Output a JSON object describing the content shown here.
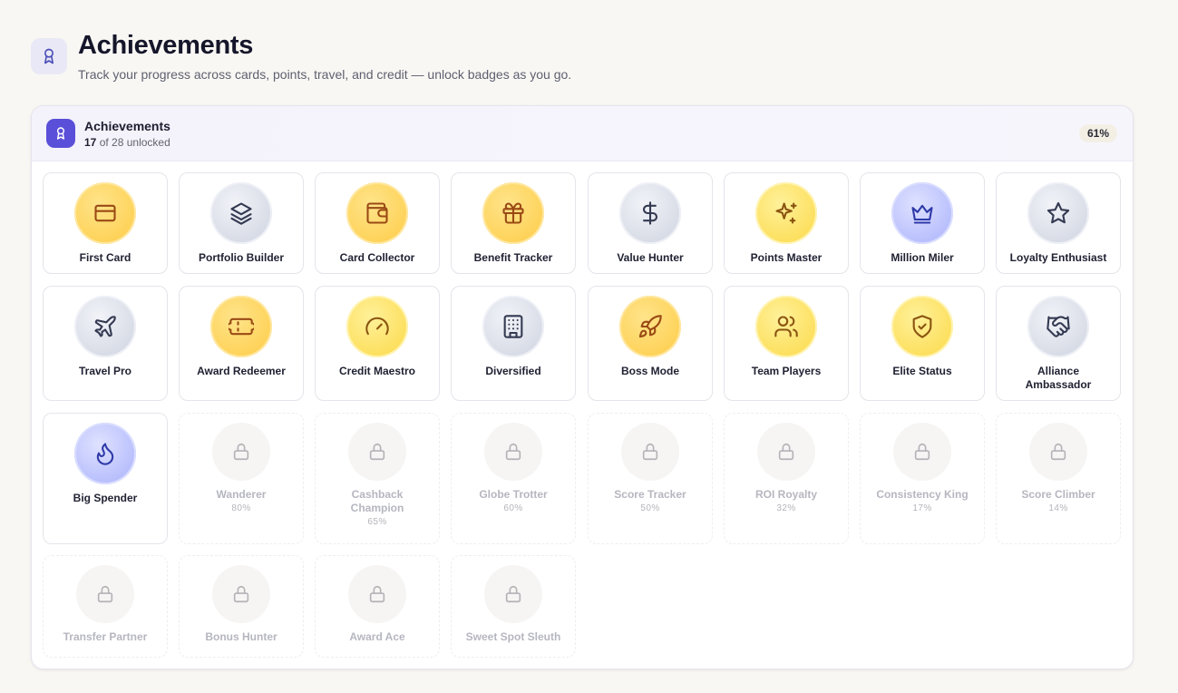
{
  "header": {
    "title": "Achievements",
    "subtitle": "Track your progress across cards, points, travel, and credit — unlock badges as you go."
  },
  "panel": {
    "title": "Achievements",
    "unlocked_count": "17",
    "count_suffix": " of 28 unlocked",
    "percent": "61%"
  },
  "colors": {
    "accent": "#5a4fd8",
    "gold": "#fdcb45",
    "yellow": "#fbd845",
    "silver": "#cdd2de",
    "blue": "#a8b0fb"
  },
  "achievements": [
    {
      "label": "First Card",
      "icon": "credit-card-icon",
      "tier": "gold",
      "unlocked": true
    },
    {
      "label": "Portfolio Builder",
      "icon": "layers-icon",
      "tier": "silver",
      "unlocked": true
    },
    {
      "label": "Card Collector",
      "icon": "wallet-icon",
      "tier": "gold",
      "unlocked": true
    },
    {
      "label": "Benefit Tracker",
      "icon": "gift-icon",
      "tier": "gold",
      "unlocked": true
    },
    {
      "label": "Value Hunter",
      "icon": "dollar-icon",
      "tier": "silver",
      "unlocked": true
    },
    {
      "label": "Points Master",
      "icon": "sparkles-icon",
      "tier": "yellow",
      "unlocked": true
    },
    {
      "label": "Million Miler",
      "icon": "crown-icon",
      "tier": "blue",
      "unlocked": true
    },
    {
      "label": "Loyalty Enthusiast",
      "icon": "star-icon",
      "tier": "silver",
      "unlocked": true
    },
    {
      "label": "Travel Pro",
      "icon": "plane-icon",
      "tier": "silver",
      "unlocked": true
    },
    {
      "label": "Award Redeemer",
      "icon": "ticket-icon",
      "tier": "gold",
      "unlocked": true
    },
    {
      "label": "Credit Maestro",
      "icon": "gauge-icon",
      "tier": "yellow",
      "unlocked": true
    },
    {
      "label": "Diversified",
      "icon": "building-icon",
      "tier": "silver",
      "unlocked": true
    },
    {
      "label": "Boss Mode",
      "icon": "rocket-icon",
      "tier": "gold",
      "unlocked": true
    },
    {
      "label": "Team Players",
      "icon": "users-icon",
      "tier": "yellow",
      "unlocked": true
    },
    {
      "label": "Elite Status",
      "icon": "shield-check-icon",
      "tier": "yellow",
      "unlocked": true
    },
    {
      "label": "Alliance Ambassador",
      "icon": "handshake-icon",
      "tier": "silver",
      "unlocked": true
    },
    {
      "label": "Big Spender",
      "icon": "flame-icon",
      "tier": "blue",
      "unlocked": true
    },
    {
      "label": "Wanderer",
      "icon": "lock-icon",
      "unlocked": false,
      "progress": "80%"
    },
    {
      "label": "Cashback Champion",
      "icon": "lock-icon",
      "unlocked": false,
      "progress": "65%"
    },
    {
      "label": "Globe Trotter",
      "icon": "lock-icon",
      "unlocked": false,
      "progress": "60%"
    },
    {
      "label": "Score Tracker",
      "icon": "lock-icon",
      "unlocked": false,
      "progress": "50%"
    },
    {
      "label": "ROI Royalty",
      "icon": "lock-icon",
      "unlocked": false,
      "progress": "32%"
    },
    {
      "label": "Consistency King",
      "icon": "lock-icon",
      "unlocked": false,
      "progress": "17%"
    },
    {
      "label": "Score Climber",
      "icon": "lock-icon",
      "unlocked": false,
      "progress": "14%"
    },
    {
      "label": "Transfer Partner",
      "icon": "lock-icon",
      "unlocked": false
    },
    {
      "label": "Bonus Hunter",
      "icon": "lock-icon",
      "unlocked": false
    },
    {
      "label": "Award Ace",
      "icon": "lock-icon",
      "unlocked": false
    },
    {
      "label": "Sweet Spot Sleuth",
      "icon": "lock-icon",
      "unlocked": false
    }
  ]
}
